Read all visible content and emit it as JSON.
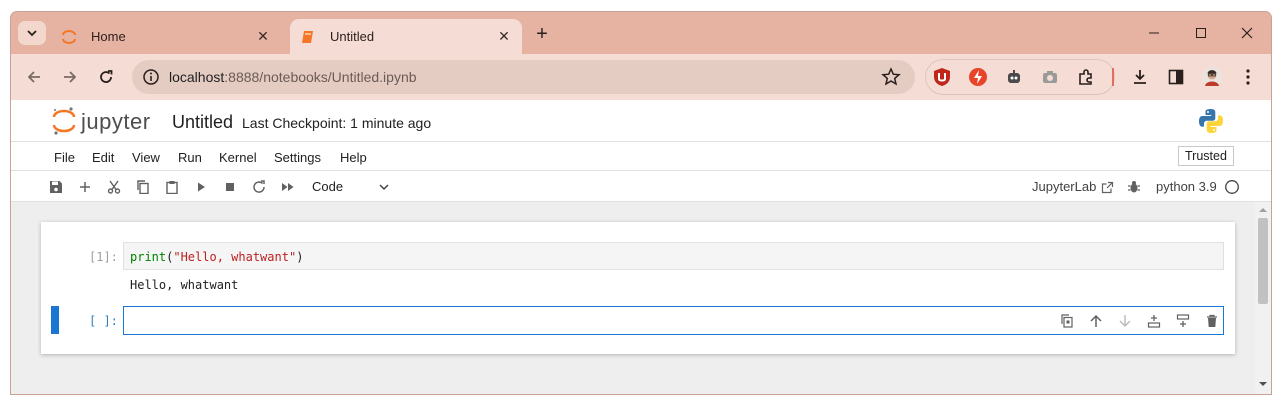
{
  "browser": {
    "tabs": [
      {
        "title": "Home",
        "icon": "jupyter-logo-icon",
        "active": false
      },
      {
        "title": "Untitled",
        "icon": "notebook-icon",
        "active": true
      }
    ],
    "new_tab_label": "+",
    "address": {
      "host": "localhost",
      "rest": ":8888/notebooks/Untitled.ipynb"
    },
    "extensions": [
      "ublock-icon",
      "lightning-ext-icon",
      "robot-ext-icon",
      "camera-ext-icon",
      "puzzle-icon"
    ],
    "accent": "#e6b2a2"
  },
  "jupyter": {
    "logo_text": "jupyter",
    "notebook_title": "Untitled",
    "checkpoint": "Last Checkpoint: 1 minute ago",
    "menu": [
      "File",
      "Edit",
      "View",
      "Run",
      "Kernel",
      "Settings",
      "Help"
    ],
    "trusted_label": "Trusted",
    "cell_type": "Code",
    "jupyterlab_link": "JupyterLab",
    "kernel": "python 3.9",
    "cells": [
      {
        "prompt": "[1]:",
        "code": {
          "fn": "print",
          "open": "(",
          "str": "\"Hello, whatwant\"",
          "close": ")"
        },
        "output": "Hello, whatwant"
      },
      {
        "prompt": "[ ]:",
        "code": "",
        "active": true
      }
    ],
    "accent": "#1976d2"
  }
}
